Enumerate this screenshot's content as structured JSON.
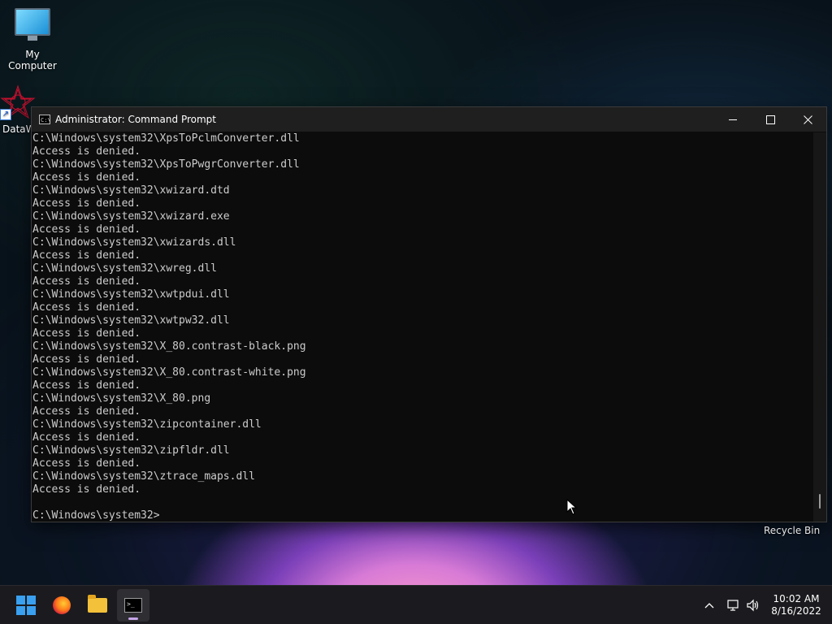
{
  "desktop": {
    "icons": [
      {
        "label": "My Computer"
      },
      {
        "label": "DataW"
      }
    ],
    "recycle_bin": "Recycle Bin"
  },
  "window": {
    "title": "Administrator: Command Prompt",
    "icon_text": "C:\\",
    "lines": [
      "C:\\Windows\\system32\\XpsToPclmConverter.dll",
      "Access is denied.",
      "C:\\Windows\\system32\\XpsToPwgrConverter.dll",
      "Access is denied.",
      "C:\\Windows\\system32\\xwizard.dtd",
      "Access is denied.",
      "C:\\Windows\\system32\\xwizard.exe",
      "Access is denied.",
      "C:\\Windows\\system32\\xwizards.dll",
      "Access is denied.",
      "C:\\Windows\\system32\\xwreg.dll",
      "Access is denied.",
      "C:\\Windows\\system32\\xwtpdui.dll",
      "Access is denied.",
      "C:\\Windows\\system32\\xwtpw32.dll",
      "Access is denied.",
      "C:\\Windows\\system32\\X_80.contrast-black.png",
      "Access is denied.",
      "C:\\Windows\\system32\\X_80.contrast-white.png",
      "Access is denied.",
      "C:\\Windows\\system32\\X_80.png",
      "Access is denied.",
      "C:\\Windows\\system32\\zipcontainer.dll",
      "Access is denied.",
      "C:\\Windows\\system32\\zipfldr.dll",
      "Access is denied.",
      "C:\\Windows\\system32\\ztrace_maps.dll",
      "Access is denied.",
      "",
      "C:\\Windows\\system32>"
    ]
  },
  "taskbar": {
    "icons": [
      "windows-start-icon",
      "firefox-icon",
      "file-explorer-icon",
      "command-prompt-icon"
    ],
    "clock": {
      "time": "10:02 AM",
      "date": "8/16/2022"
    }
  },
  "colors": {
    "console_bg": "#0c0c0c",
    "console_text": "#cccccc",
    "titlebar_bg": "#1f1f1f",
    "taskbar_bg": "#1b1b1f"
  }
}
